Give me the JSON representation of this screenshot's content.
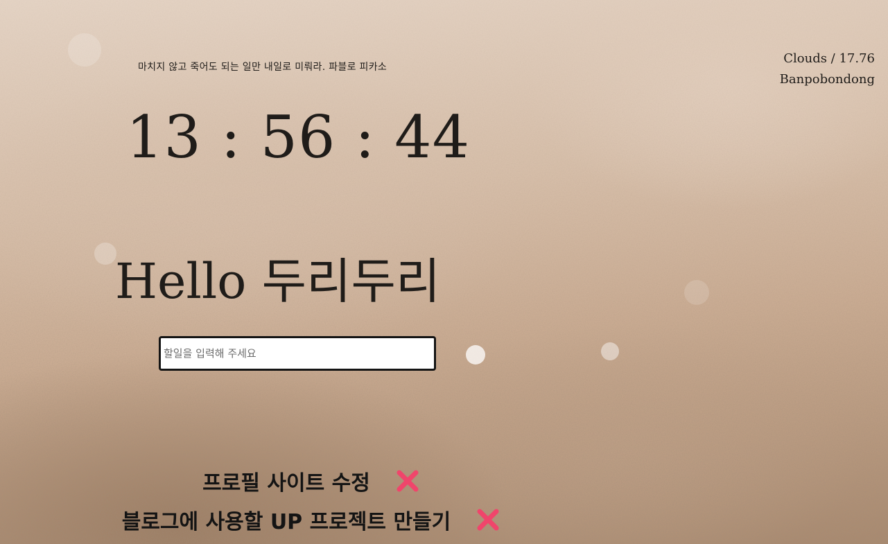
{
  "quote": {
    "text": "마치지 않고 죽어도 되는 일만 내일로 미뤄라. 파블로 피카소"
  },
  "weather": {
    "summary": "Clouds / 17.76",
    "location": "Banpobondong"
  },
  "clock": {
    "time": "13 : 56 : 44"
  },
  "greeting": {
    "text": "Hello 두리두리"
  },
  "todo_form": {
    "placeholder": "할일을 입력해 주세요",
    "value": ""
  },
  "todos": [
    {
      "text": "프로필 사이트 수정",
      "delete_icon": "close-x-icon"
    },
    {
      "text": "블로그에 사용할 UP 프로젝트 만들기",
      "delete_icon": "close-x-icon"
    }
  ],
  "colors": {
    "delete_icon": "#f0456b",
    "text": "#1f1c19",
    "input_border": "#141414"
  }
}
